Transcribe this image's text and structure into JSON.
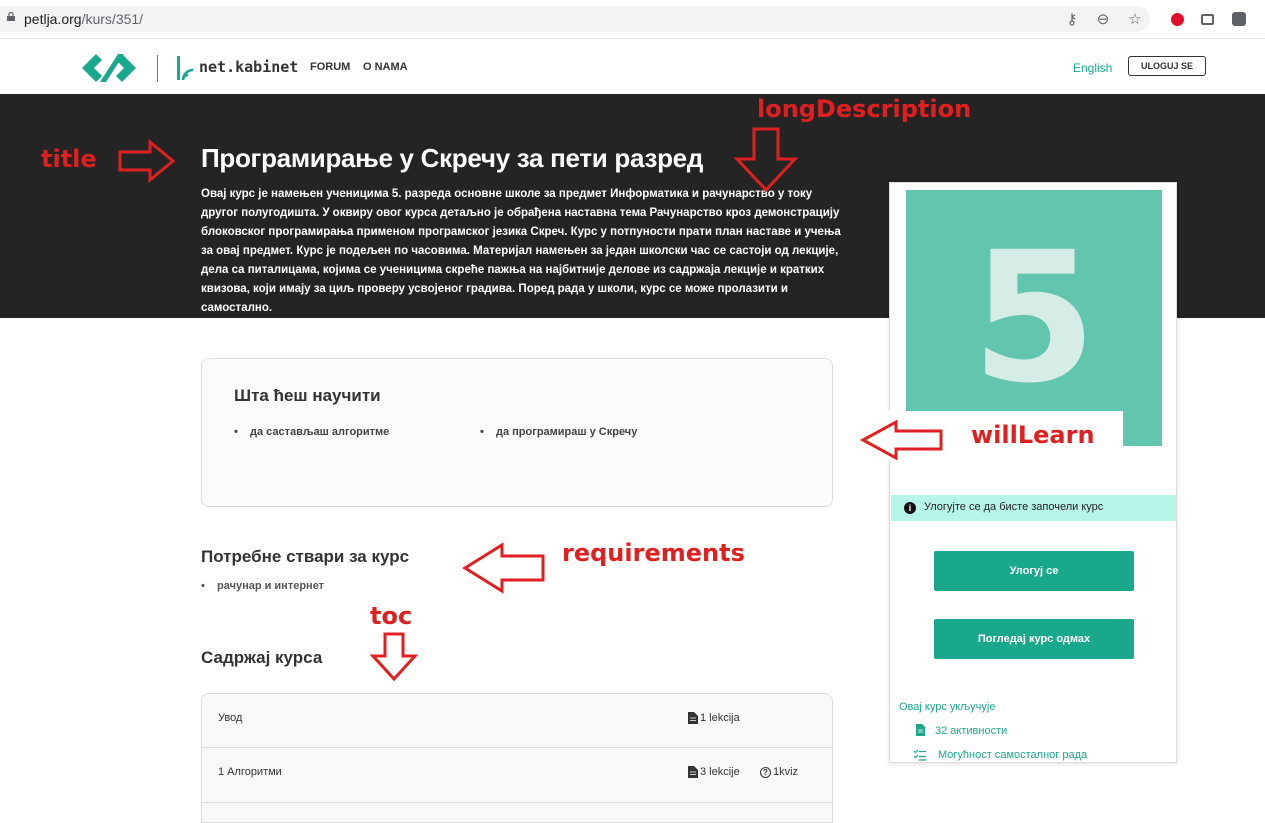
{
  "browser": {
    "url_host": "petlja.org",
    "url_path": "/kurs/351/",
    "icons": [
      "key-icon",
      "zoom-icon",
      "star-icon",
      "opera-icon",
      "cast-icon",
      "profile-icon"
    ]
  },
  "header": {
    "brand": "net.kabinet",
    "nav": [
      "FORUM",
      "O NAMA"
    ],
    "language": "English",
    "login_button": "ULOGUJ SE"
  },
  "hero": {
    "title": "Програмирање у Скречу за пети разред",
    "long_description": "Овај курс је намењен ученицима 5. разреда основне школе за предмет Информатика и рачунарство у току другог полугодишта. У оквиру овог курса детаљно је обрађена наставна тема Рачунарство кроз демонстрацију блоковског програмирања применом програмског језика Скреч. Курс у потпуности прати план наставе и учења за овај предмет. Курс је подељен по часовима. Материјал намењен за један школски час се састоји од лекције, дела са питалицама, којима се ученицима скреће пажња на најбитније делове из садржаја лекције и кратких квизова, који имају за циљ проверу усвојеног градива. Поред рада у школи, курс се може пролазити и самостално."
  },
  "card": {
    "thumbnail_number": "5",
    "notice": "Улогујте се да бисте започели курс",
    "login_button": "Улогуј се",
    "preview_button": "Погледај курс одмах",
    "includes_title": "Овај курс укључује",
    "includes": [
      {
        "icon": "document-icon",
        "text": "32 активности"
      },
      {
        "icon": "checklist-icon",
        "text": "Могућност самосталног рада"
      }
    ]
  },
  "will_learn": {
    "title": "Шта ћеш научити",
    "items": [
      "да састављаш алгоритме",
      "да програмираш у Скречу"
    ]
  },
  "requirements": {
    "title": "Потребне ствари за курс",
    "items": [
      "рачунар и интернет"
    ]
  },
  "toc": {
    "title": "Садржај курса",
    "rows": [
      {
        "name": "Увод",
        "lessons": "1 lekcija",
        "quiz": ""
      },
      {
        "name": "1 Алгоритми",
        "lessons": "3 lekcije",
        "quiz": "1kviz"
      }
    ]
  },
  "annotations": {
    "title": "title",
    "long_description": "longDescription",
    "will_learn": "willLearn",
    "requirements": "requirements",
    "toc": "toc",
    "color": "#e02020"
  },
  "colors": {
    "accent": "#1aa88d",
    "hero_bg": "#242424",
    "thumbnail_bg": "#62c5ad",
    "notice_bg": "#b7f5e8"
  }
}
